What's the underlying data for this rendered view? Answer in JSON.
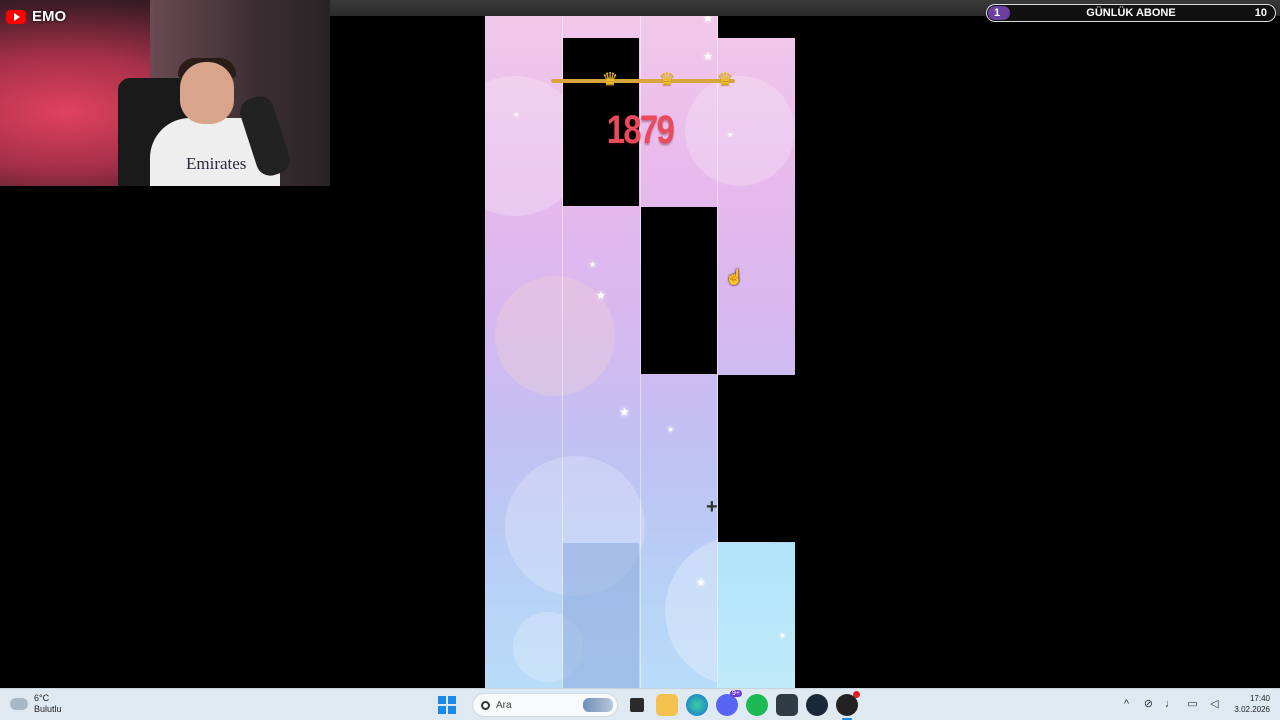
{
  "stream_overlay": {
    "channel_name": "EMO",
    "platform_icon": "youtube-icon",
    "webcam_shirt_text": "Emirates",
    "sub_goal": {
      "title": "GÜNLÜK ABONE",
      "current": "1",
      "target": "10",
      "progress_fraction": 0.1,
      "bar_color": "#6b3fa0"
    }
  },
  "game": {
    "title_hint": "piano-tiles",
    "score": "1879",
    "crowns": [
      "crown-icon",
      "crown-icon",
      "crown-icon"
    ],
    "lanes": 4,
    "tile_color": "#000000",
    "score_color": "#e94a5c",
    "crown_color": "#f4c430"
  },
  "taskbar": {
    "weather": {
      "temp": "6°C",
      "condition": "Bulutlu"
    },
    "search_placeholder": "Ara",
    "apps": [
      "file-explorer",
      "edge",
      "discord",
      "spotify",
      "terminal",
      "steam",
      "game"
    ],
    "discord_badge": "9+",
    "time": "17:40",
    "date": "3.02.2026"
  }
}
